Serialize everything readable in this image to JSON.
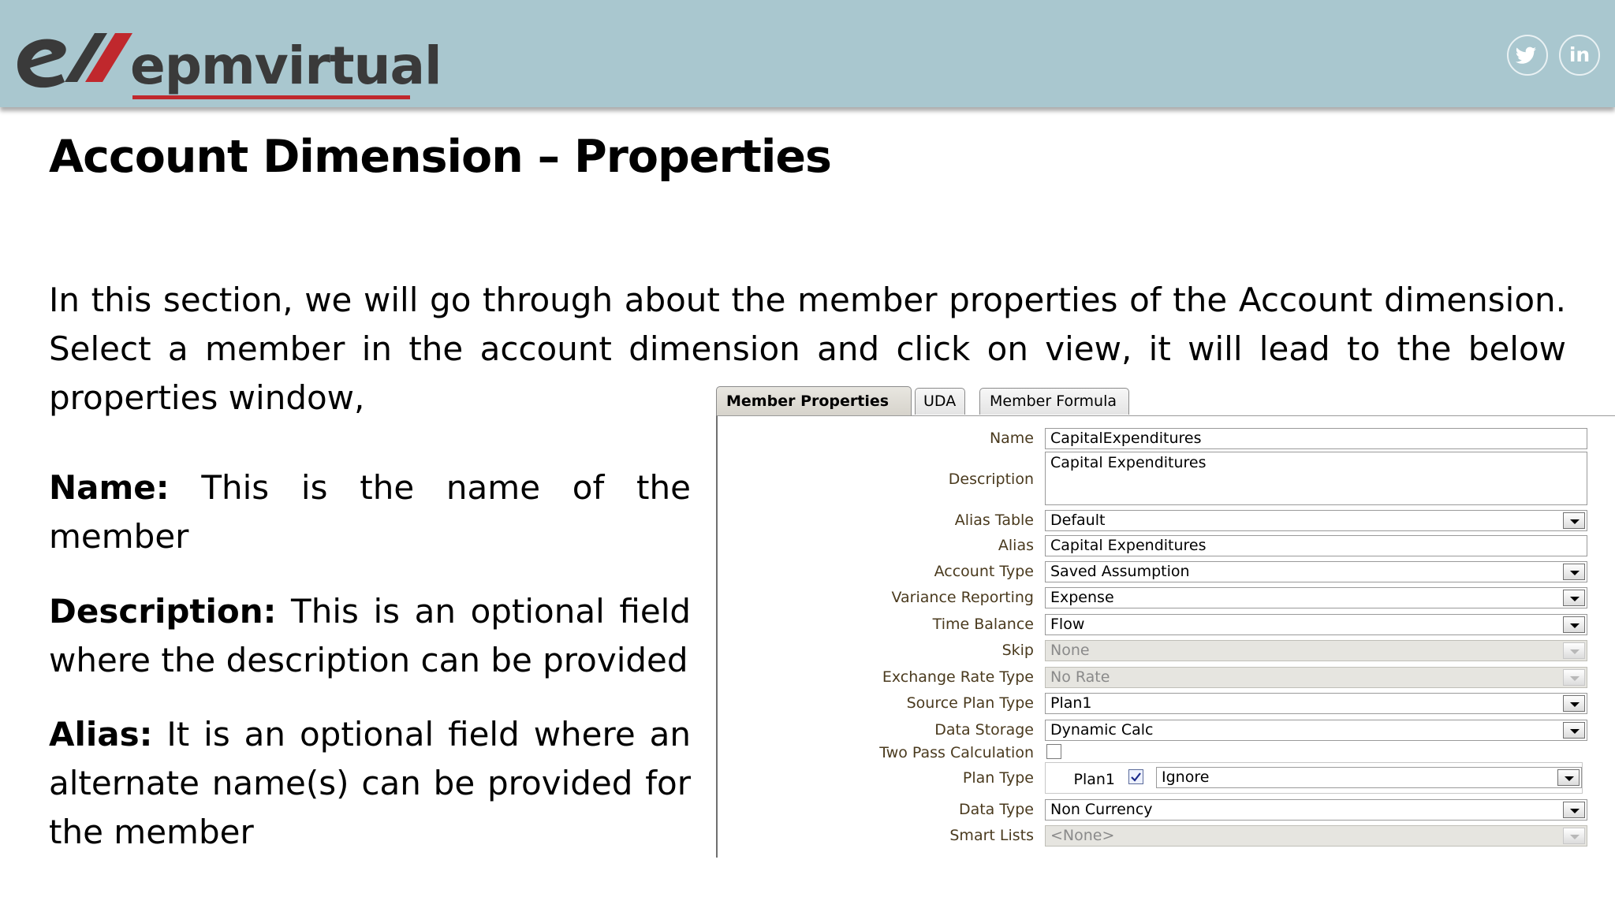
{
  "brand": {
    "name": "epmvirtual",
    "accent": "#c0282d",
    "banner_color": "#a9c7cf"
  },
  "social": [
    {
      "name": "twitter-icon"
    },
    {
      "name": "linkedin-icon",
      "text": "in"
    }
  ],
  "slide": {
    "title": "Account Dimension – Properties",
    "intro": "In this section, we will go through about the member properties of the Account dimension. Select a member in the account dimension and click on view, it will lead to the below properties window,",
    "points": [
      {
        "term": "Name:",
        "text": " This is the name of the member"
      },
      {
        "term": "Description:",
        "text": " This is an optional field where the description can be provided"
      },
      {
        "term": "Alias:",
        "text": " It is an optional field where an alternate name(s) can be provided for the member"
      }
    ]
  },
  "window": {
    "tabs": [
      "Member Properties",
      "UDA",
      "Member Formula"
    ],
    "active_tab": "Member Properties",
    "fields": {
      "name": {
        "label": "Name",
        "value": "CapitalExpenditures"
      },
      "description": {
        "label": "Description",
        "value": "Capital Expenditures"
      },
      "alias_table": {
        "label": "Alias Table",
        "value": "Default"
      },
      "alias": {
        "label": "Alias",
        "value": "Capital Expenditures"
      },
      "account_type": {
        "label": "Account Type",
        "value": "Saved Assumption"
      },
      "variance_reporting": {
        "label": "Variance Reporting",
        "value": "Expense"
      },
      "time_balance": {
        "label": "Time Balance",
        "value": "Flow"
      },
      "skip": {
        "label": "Skip",
        "value": "None"
      },
      "exchange_rate_type": {
        "label": "Exchange Rate Type",
        "value": "No Rate"
      },
      "source_plan_type": {
        "label": "Source Plan Type",
        "value": "Plan1"
      },
      "data_storage": {
        "label": "Data Storage",
        "value": "Dynamic Calc"
      },
      "two_pass": {
        "label": "Two Pass Calculation",
        "checked": false
      },
      "plan_type": {
        "label": "Plan Type",
        "plan": "Plan1",
        "checked": true,
        "aggregation": "Ignore"
      },
      "data_type": {
        "label": "Data Type",
        "value": "Non Currency"
      },
      "smart_lists": {
        "label": "Smart Lists",
        "value": "<None>"
      }
    }
  }
}
